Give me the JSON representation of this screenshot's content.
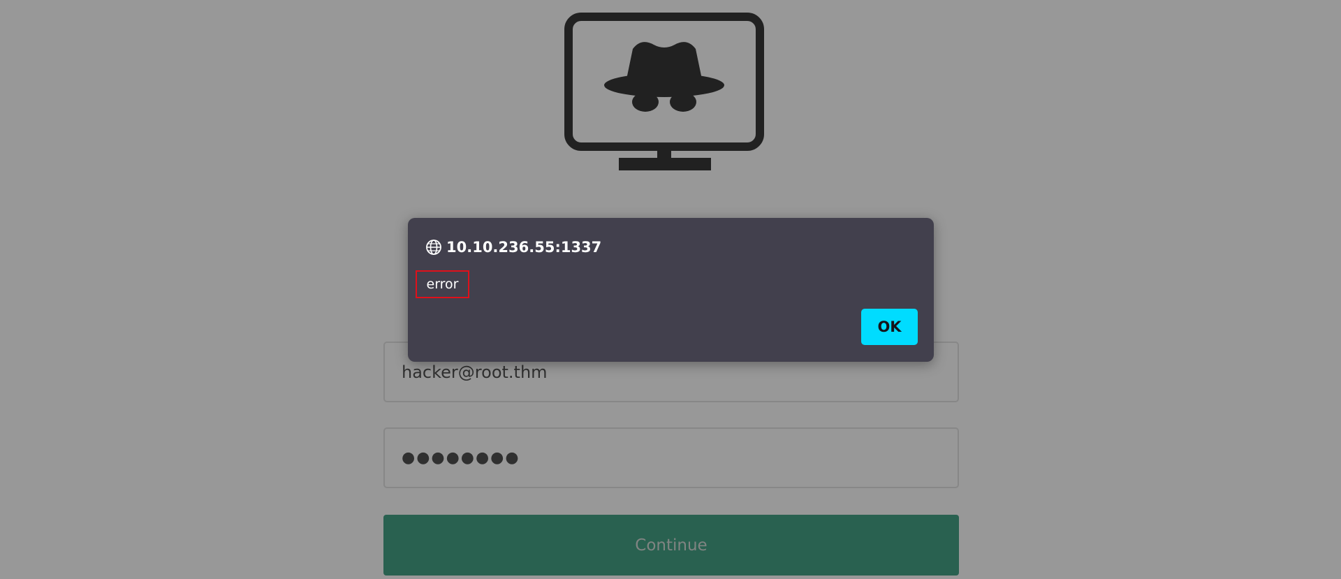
{
  "page": {
    "email_value": "hacker@root.thm",
    "password_value": "●●●●●●●●",
    "continue_label": "Continue",
    "logo_icon": "hacker-monitor-icon"
  },
  "dialog": {
    "origin": "10.10.236.55:1337",
    "message": "error",
    "ok_label": "OK",
    "origin_icon": "globe-icon"
  },
  "colors": {
    "dialog_bg": "#42404d",
    "ok_button": "#00dcff",
    "continue_button": "#21906f",
    "highlight_border": "#e0101a"
  }
}
